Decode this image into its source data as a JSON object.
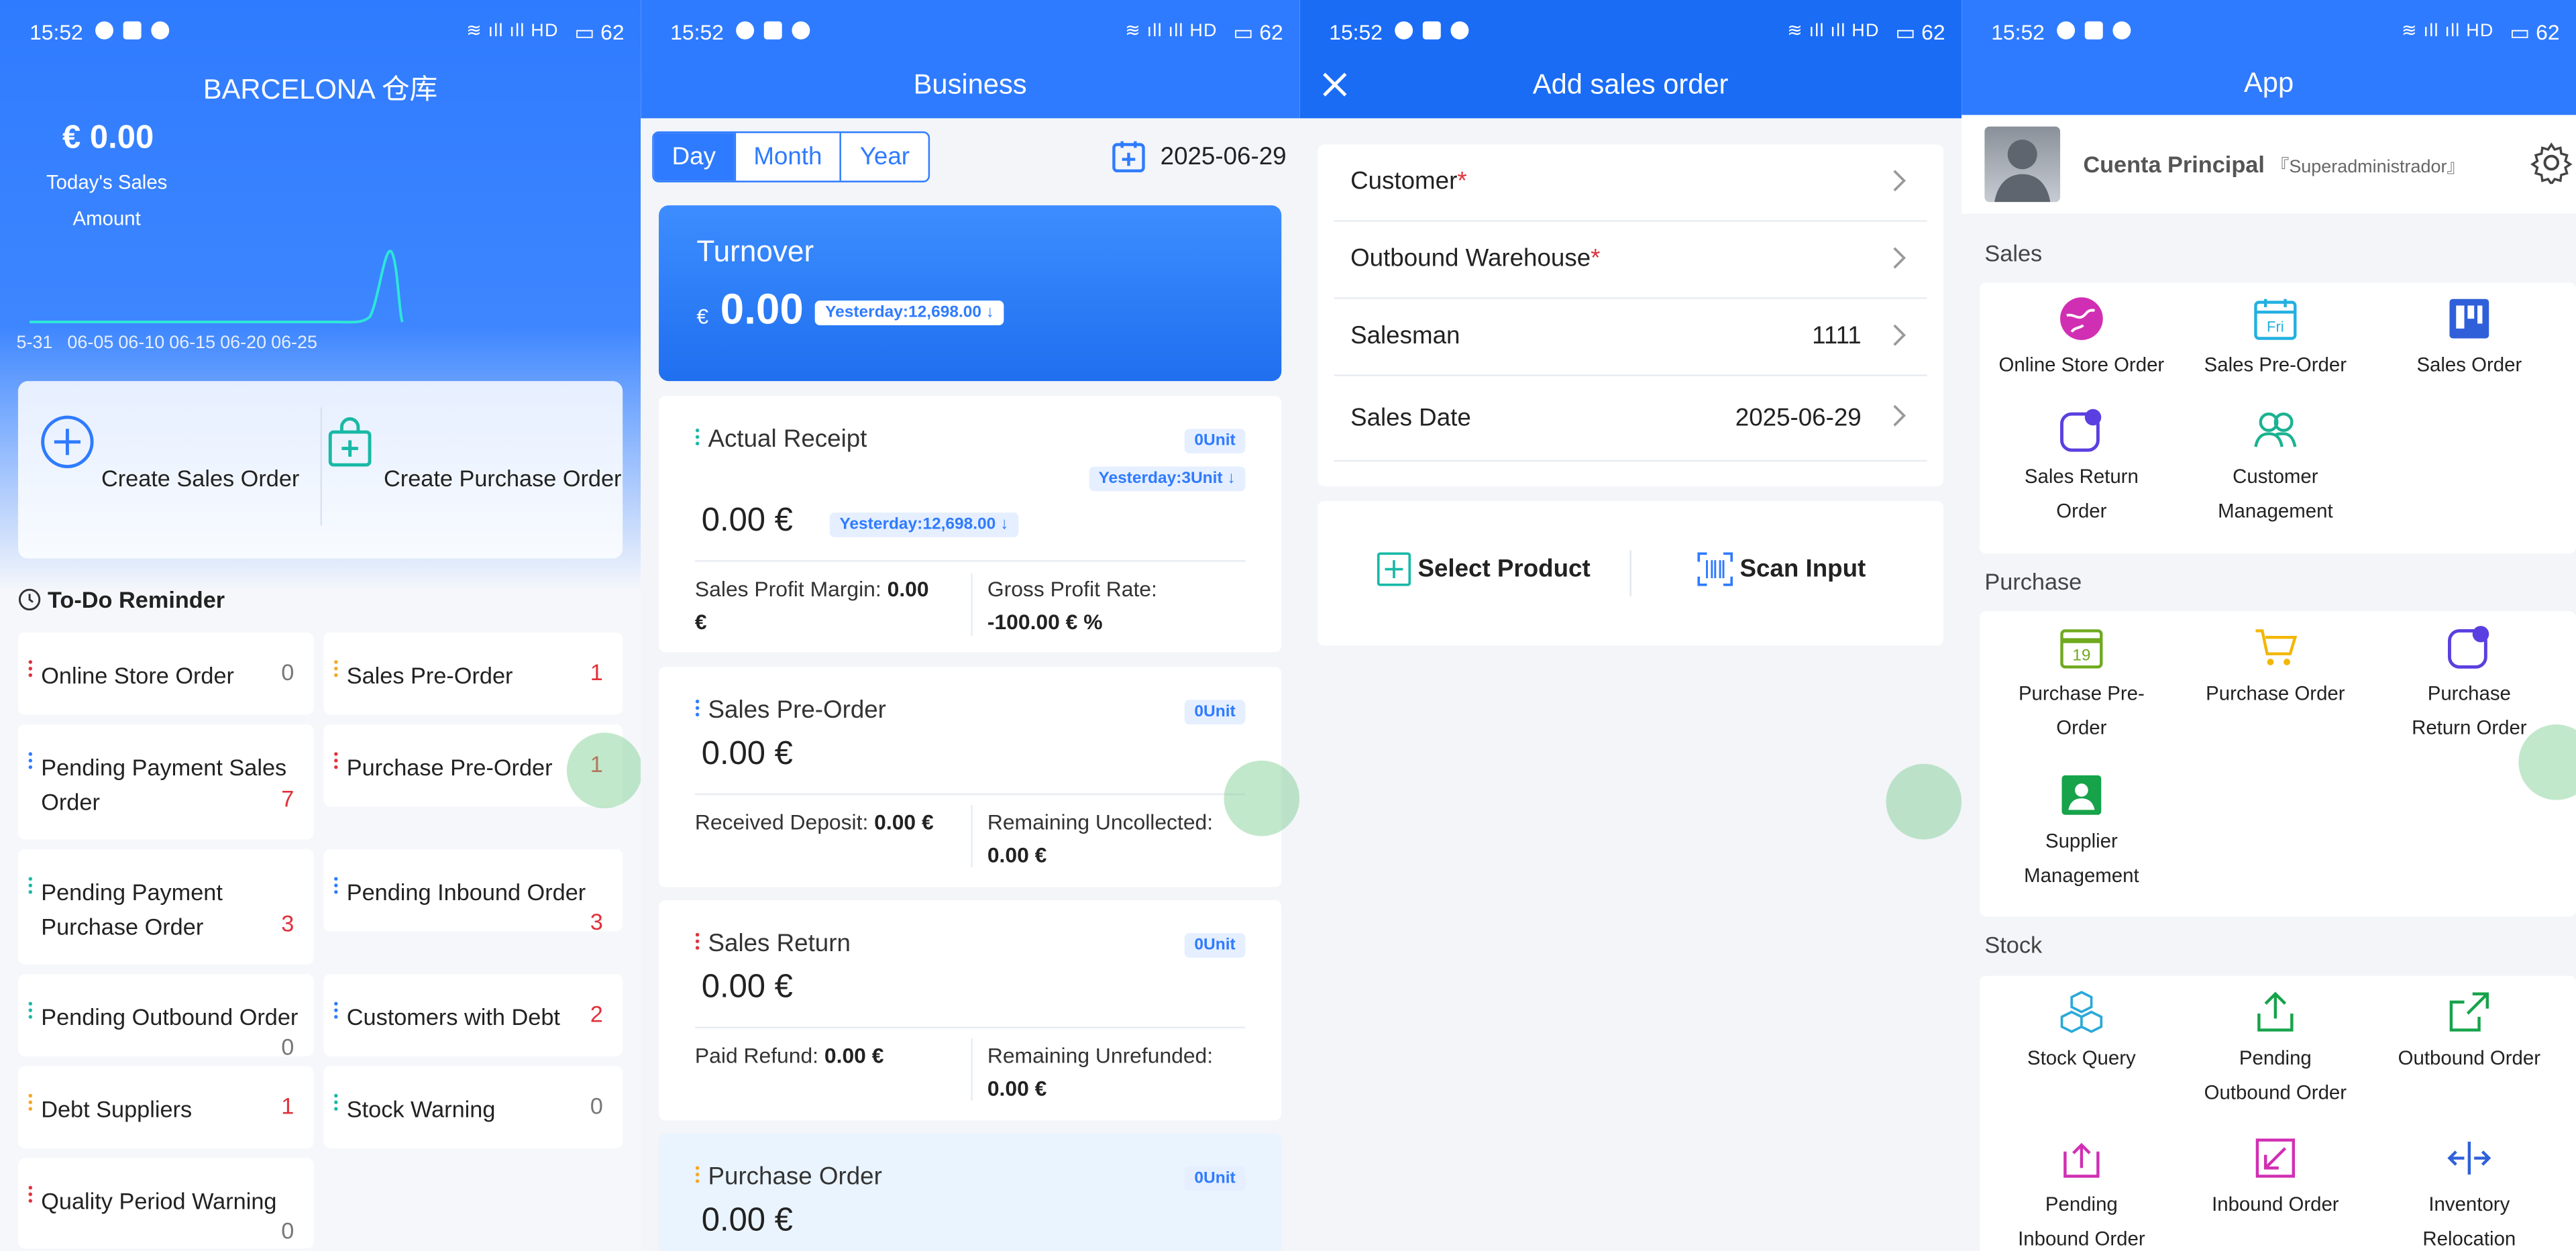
{
  "status": {
    "time": "15:52",
    "right": "HD 62",
    "battery": "62"
  },
  "p1": {
    "title": "BARCELONA 仓库",
    "today_amount": "€ 0.00",
    "today_label_1": "Today's Sales",
    "today_label_2": "Amount",
    "xticks": [
      "5-31",
      "06-05",
      "06-10",
      "06-15",
      "06-20",
      "06-25"
    ],
    "create_sales": "Create Sales Order",
    "create_purchase": "Create Purchase Order",
    "todo_title": "To-Do Reminder",
    "todo": [
      {
        "label": "Online Store Order",
        "count": "0"
      },
      {
        "label": "Sales Pre-Order",
        "count": "1"
      },
      {
        "label": "Pending Payment Sales Order",
        "count": "7"
      },
      {
        "label": "Purchase Pre-Order",
        "count": "1"
      },
      {
        "label": "Pending Payment Purchase Order",
        "count": "3"
      },
      {
        "label": "Pending Inbound Order",
        "count": "3"
      },
      {
        "label": "Pending Outbound Order",
        "count": "0"
      },
      {
        "label": "Customers with Debt",
        "count": "2"
      },
      {
        "label": "Debt Suppliers",
        "count": "1"
      },
      {
        "label": "Stock Warning",
        "count": "0"
      },
      {
        "label": "Quality Period Warning",
        "count": "0"
      }
    ]
  },
  "p2": {
    "title": "Business",
    "tabs": [
      "Day",
      "Month",
      "Year"
    ],
    "date": "2025-06-29",
    "turnover_title": "Turnover",
    "turnover_currency": "€",
    "turnover_value": "0.00",
    "turnover_yesterday": "Yesterday:12,698.00 ↓",
    "actual": {
      "title": "Actual Receipt",
      "unit": "0Unit",
      "yesterday_unit": "Yesterday:3Unit ↓",
      "value": "0.00 €",
      "yesterday": "Yesterday:12,698.00 ↓",
      "l1": "Sales Profit Margin:",
      "v1": "0.00",
      "v1b": "€",
      "l2": "Gross Profit Rate:",
      "v2": "-100.00 € %"
    },
    "preorder": {
      "title": "Sales Pre-Order",
      "unit": "0Unit",
      "value": "0.00 €",
      "l1": "Received Deposit:",
      "v1": "0.00 €",
      "l2": "Remaining Uncollected:",
      "v2": "0.00 €"
    },
    "return": {
      "title": "Sales Return",
      "unit": "0Unit",
      "value": "0.00 €",
      "l1": "Paid Refund:",
      "v1": "0.00 €",
      "l2": "Remaining Unrefunded:",
      "v2": "0.00 €"
    },
    "purchase": {
      "title": "Purchase Order",
      "unit": "0Unit",
      "value": "0.00 €"
    }
  },
  "p3": {
    "title": "Add sales order",
    "rows": [
      {
        "label": "Customer",
        "value": ""
      },
      {
        "label": "Outbound Warehouse",
        "value": ""
      },
      {
        "label": "Salesman",
        "value": "1111"
      },
      {
        "label": "Sales Date",
        "value": "2025-06-29"
      }
    ],
    "required_mark": "*",
    "select_product": "Select Product",
    "scan_input": "Scan Input"
  },
  "p4": {
    "title": "App",
    "user_name": "Cuenta Principal",
    "user_role": "『Superadministrador』",
    "sections": {
      "sales": "Sales",
      "purchase": "Purchase",
      "stock": "Stock"
    },
    "sales_items": [
      "Online Store Order",
      "Sales Pre-Order",
      "Sales Order",
      "Sales Return Order",
      "Customer Management"
    ],
    "purchase_items": [
      "Purchase Pre-Order",
      "Purchase Order",
      "Purchase Return Order",
      "Supplier Management"
    ],
    "stock_items": [
      "Stock Query",
      "Pending Outbound Order",
      "Outbound Order",
      "Pending Inbound Order",
      "Inbound Order",
      "Inventory Relocation"
    ],
    "calendar_day": "19",
    "calendar_fri": "Fri"
  },
  "colors": {
    "primary": "#2f7bff",
    "red": "#e0313b",
    "teal": "#18b9a6"
  }
}
